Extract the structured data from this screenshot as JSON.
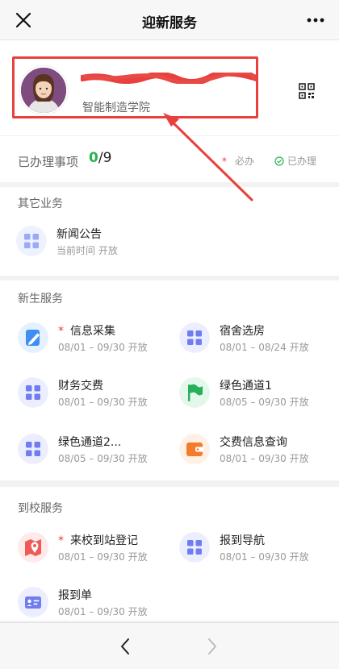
{
  "header": {
    "title": "迎新服务"
  },
  "profile": {
    "college": "智能制造学院"
  },
  "stats": {
    "label": "已办理事项",
    "done": "0",
    "total": "/9",
    "required_label": "必办",
    "finished_label": "已办理"
  },
  "sections": {
    "other": {
      "title": "其它业务",
      "items": [
        {
          "name": "新闻公告",
          "sub": "当前时间 开放"
        }
      ]
    },
    "freshman": {
      "title": "新生服务",
      "items": [
        {
          "name": "信息采集",
          "sub": "08/01 – 09/30 开放"
        },
        {
          "name": "宿舍选房",
          "sub": "08/01 – 08/24 开放"
        },
        {
          "name": "财务交费",
          "sub": "08/01 – 09/30 开放"
        },
        {
          "name": "绿色通道1",
          "sub": "08/05 – 09/30 开放"
        },
        {
          "name": "绿色通道2...",
          "sub": "08/05 – 09/30 开放"
        },
        {
          "name": "交费信息查询",
          "sub": "08/01 – 09/30 开放"
        }
      ]
    },
    "arrival": {
      "title": "到校服务",
      "items": [
        {
          "name": "来校到站登记",
          "sub": "08/01 – 09/30 开放"
        },
        {
          "name": "报到导航",
          "sub": "08/01 – 09/30 开放"
        },
        {
          "name": "报到单",
          "sub": "08/01 – 09/30 开放"
        }
      ]
    }
  },
  "required_mark": "*",
  "colors": {
    "accent_red": "#e8403d",
    "done_green": "#2bb24c",
    "icon_blue": "#6f7df0"
  }
}
